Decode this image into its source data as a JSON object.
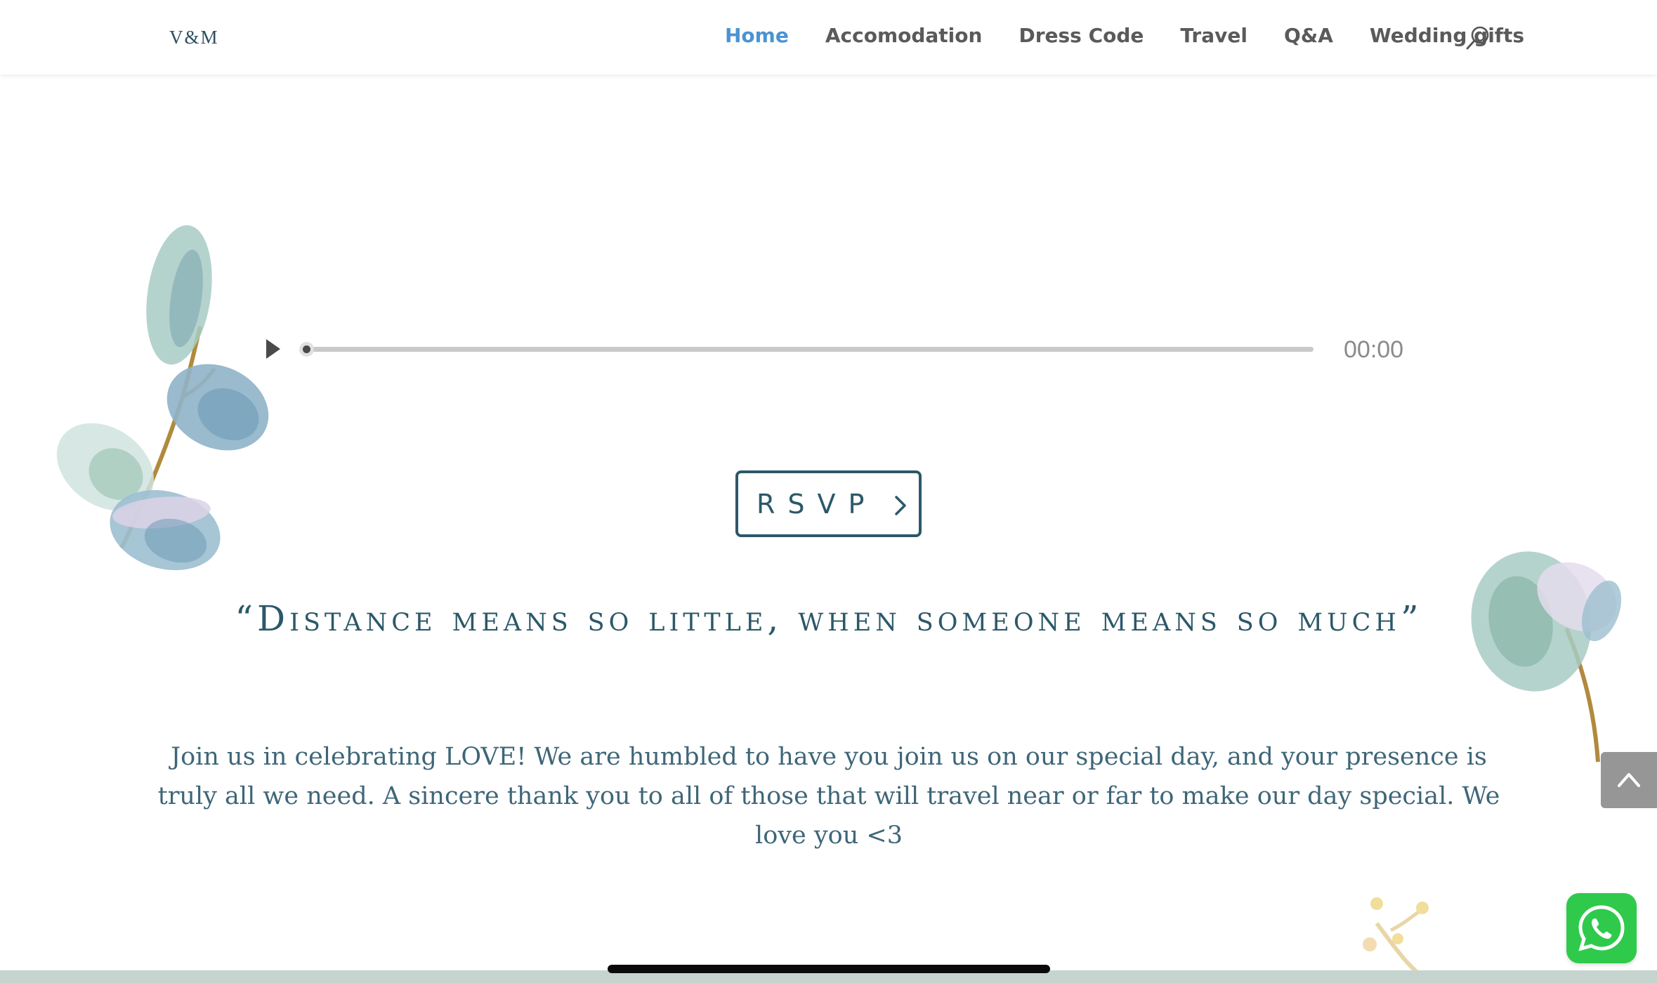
{
  "header": {
    "logo": "V&M",
    "nav": [
      {
        "label": "Home",
        "active": true
      },
      {
        "label": "Accomodation",
        "active": false
      },
      {
        "label": "Dress Code",
        "active": false
      },
      {
        "label": "Travel",
        "active": false
      },
      {
        "label": "Q&A",
        "active": false
      },
      {
        "label": "Wedding gifts",
        "active": false
      }
    ],
    "search_icon": "search-icon"
  },
  "audio_player": {
    "time": "00:00",
    "progress": 0,
    "play_icon": "play-icon"
  },
  "rsvp": {
    "label": "RSVP",
    "icon": "chevron-right-icon"
  },
  "quote": "“Distance means so little, when someone means so much”",
  "body_text": "Join us in celebrating LOVE!  We are humbled to have you join us on our special day, and your presence is truly all we need. A sincere thank you to all of those that will travel near or far to make our day special. We love you <3",
  "floating": {
    "back_to_top_icon": "chevron-up-icon",
    "whatsapp_icon": "whatsapp-icon"
  },
  "colors": {
    "accent": "#4a93d1",
    "brand": "#2c5869",
    "nav_text": "#5a5a5a",
    "whatsapp": "#2fca4b"
  }
}
